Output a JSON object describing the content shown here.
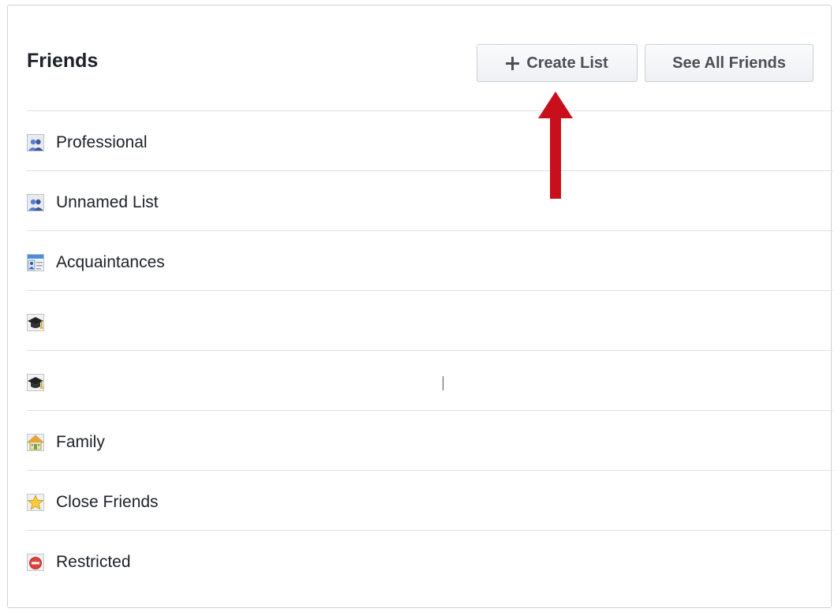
{
  "header": {
    "title": "Friends",
    "create_list_label": "Create List",
    "see_all_label": "See All Friends"
  },
  "lists": [
    {
      "label": "Professional",
      "icon": "people-list-icon"
    },
    {
      "label": "Unnamed List",
      "icon": "people-list-icon"
    },
    {
      "label": "Acquaintances",
      "icon": "id-card-icon"
    },
    {
      "label": "",
      "icon": "graduation-cap-icon"
    },
    {
      "label": "",
      "icon": "graduation-cap-icon"
    },
    {
      "label": "Family",
      "icon": "house-icon"
    },
    {
      "label": "Close Friends",
      "icon": "star-icon"
    },
    {
      "label": "Restricted",
      "icon": "restricted-icon"
    }
  ],
  "colors": {
    "annotation_arrow": "#c8101c",
    "title_text": "#1d2129",
    "button_text": "#4b4f56"
  }
}
